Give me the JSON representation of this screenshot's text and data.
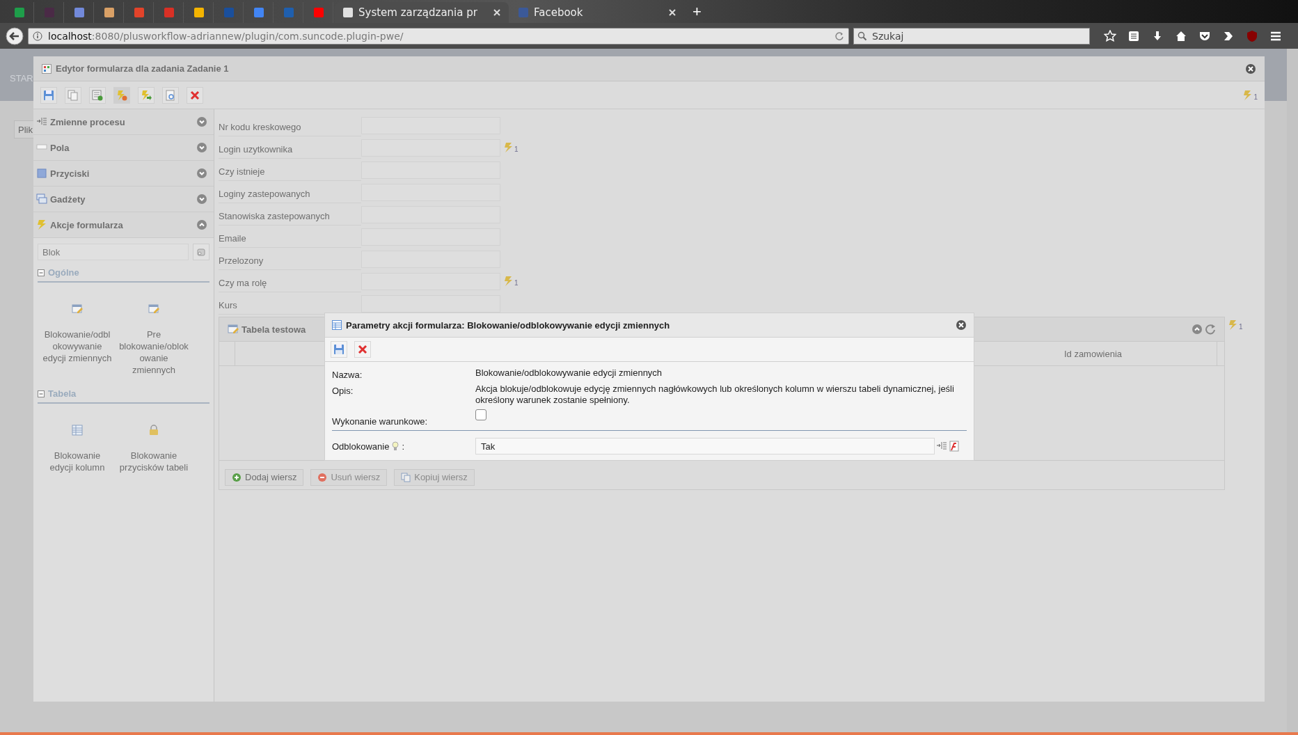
{
  "browser": {
    "tabs": [
      {
        "kind": "pinned",
        "color": "#1e9e4a"
      },
      {
        "kind": "pinned",
        "color": "#4a2a46"
      },
      {
        "kind": "pinned",
        "color": "#7289da"
      },
      {
        "kind": "pinned",
        "color": "#d9a066"
      },
      {
        "kind": "pinned",
        "color": "#e2432a"
      },
      {
        "kind": "pinned",
        "color": "#d93025"
      },
      {
        "kind": "pinned",
        "color": "#f4b400"
      },
      {
        "kind": "pinned",
        "color": "#1a4f9c"
      },
      {
        "kind": "pinned",
        "color": "#4285f4"
      },
      {
        "kind": "pinned",
        "color": "#1f5fae"
      },
      {
        "kind": "pinned",
        "color": "#ff0000"
      },
      {
        "kind": "page",
        "label": "System zarządzania pr",
        "selected": true
      },
      {
        "kind": "page",
        "label": "Facebook",
        "selected": false
      }
    ],
    "new_tab": "+",
    "address": {
      "host": "localhost",
      "path": ":8080/plusworkflow-adriannew/plugin/com.suncode.plugin-pwe/"
    },
    "search": {
      "placeholder": "Szukaj"
    }
  },
  "background": {
    "nav_label": "STAR",
    "search_placeholder": "Plik"
  },
  "editor": {
    "title": "Edytor formularza dla zadania Zadanie 1",
    "actions_count": "1",
    "sections": [
      {
        "kind": "variables",
        "label": "Zmienne procesu",
        "expanded": false
      },
      {
        "kind": "fields",
        "label": "Pola",
        "expanded": false
      },
      {
        "kind": "buttons",
        "label": "Przyciski",
        "expanded": false
      },
      {
        "kind": "gadgets",
        "label": "Gadżety",
        "expanded": false
      },
      {
        "kind": "actions",
        "label": "Akcje formularza",
        "expanded": true
      }
    ],
    "filter": {
      "value": "Blok"
    },
    "groups": [
      {
        "title": "Ogólne",
        "expanded": true,
        "items": [
          {
            "kind": "edit",
            "label": "Blokowanie/odblokowywanie edycji zmiennych"
          },
          {
            "kind": "edit",
            "label": "Pre blokowanie/oblokowanie zmiennych"
          }
        ]
      },
      {
        "title": "Tabela",
        "expanded": true,
        "items": [
          {
            "kind": "grid",
            "label": "Blokowanie edycji kolumn"
          },
          {
            "kind": "lock",
            "label": "Blokowanie przycisków tabeli"
          }
        ]
      }
    ],
    "fields": [
      {
        "label": "Nr kodu kreskowego"
      },
      {
        "label": "Login uzytkownika",
        "actions": "1"
      },
      {
        "label": "Czy istnieje"
      },
      {
        "label": "Loginy zastepowanych"
      },
      {
        "label": "Stanowiska zastepowanych"
      },
      {
        "label": "Emaile"
      },
      {
        "label": "Przelozony"
      },
      {
        "label": "Czy ma rolę",
        "actions": "1"
      },
      {
        "label": "Kurs"
      }
    ],
    "table": {
      "title": "Tabela testowa",
      "actions": "1",
      "columns": [
        "Id zamowienia"
      ],
      "buttons": [
        {
          "kind": "add",
          "label": "Dodaj wiersz",
          "disabled": false
        },
        {
          "kind": "remove",
          "label": "Usuń wiersz",
          "disabled": true
        },
        {
          "kind": "copy",
          "label": "Kopiuj wiersz",
          "disabled": true
        }
      ]
    }
  },
  "dialog": {
    "title": "Parametry akcji formularza: Blokowanie/odblokowywanie edycji zmiennych",
    "name_label": "Nazwa:",
    "name_value": "Blokowanie/odblokowywanie edycji zmiennych",
    "description_label": "Opis:",
    "description_value": "Akcja blokuje/odblokowuje edycję zmiennych nagłówkowych lub określonych kolumn w wierszu tabeli dynamicznej, jeśli określony warunek zostanie spełniony.",
    "conditional_label": "Wykonanie warunkowe:",
    "conditional_checked": false,
    "unlock_label": "Odblokowanie",
    "unlock_colon": ":",
    "unlock_value": "Tak"
  }
}
